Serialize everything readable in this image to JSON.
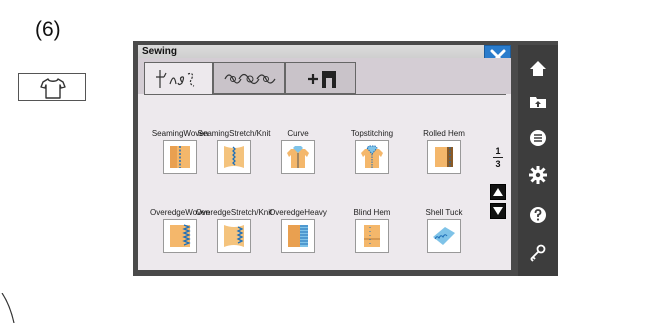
{
  "step_label": "(6)",
  "screen": {
    "title": "Sewing",
    "close_icon": "close-icon",
    "tabs": [
      {
        "icon": "utility-stitch-icon",
        "active": true
      },
      {
        "icon": "decorative-stitch-icon",
        "active": false
      },
      {
        "icon": "add-stitch-icon",
        "active": false
      }
    ],
    "stitches_row1": [
      {
        "label_l1": "Seaming",
        "label_l2": "Woven"
      },
      {
        "label_l1": "Seaming",
        "label_l2": "Stretch/Knit"
      },
      {
        "label_l1": "",
        "label_l2": "Curve"
      },
      {
        "label_l1": "",
        "label_l2": "Topstitching"
      },
      {
        "label_l1": "",
        "label_l2": "Rolled Hem"
      }
    ],
    "stitches_row2": [
      {
        "label_l1": "Overedge",
        "label_l2": "Woven"
      },
      {
        "label_l1": "Overedge",
        "label_l2": "Stretch/Knit"
      },
      {
        "label_l1": "Overedge",
        "label_l2": "Heavy"
      },
      {
        "label_l1": "",
        "label_l2": "Blind Hem"
      },
      {
        "label_l1": "",
        "label_l2": "Shell Tuck"
      }
    ],
    "page": {
      "current": "1",
      "total": "3"
    },
    "sidebar": [
      "home-icon",
      "folder-icon",
      "menu-icon",
      "settings-icon",
      "help-icon",
      "key-icon"
    ],
    "colors": {
      "close": "#2a7ccc",
      "sidebar": "#3d3d3d",
      "panel": "#ede9ed"
    }
  }
}
